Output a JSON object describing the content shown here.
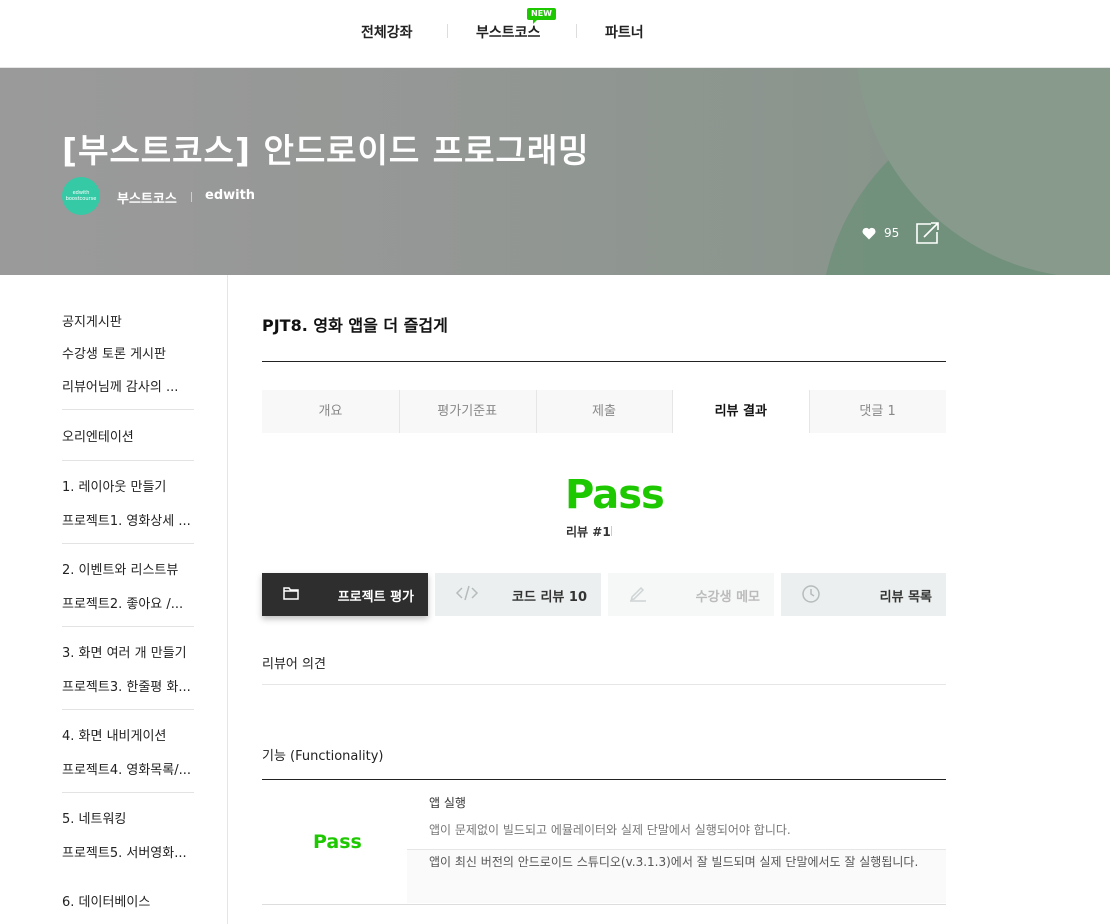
{
  "topnav": {
    "items": [
      "전체강좌",
      "부스트코스",
      "파트너"
    ],
    "new_badge": "NEW"
  },
  "hero": {
    "title": "[부스트코스] 안드로이드 프로그래밍",
    "logo_text_1": "edwith",
    "logo_text_2": "boostcourse",
    "org": "부스트코스",
    "institution": "edwith",
    "likes": "95"
  },
  "sidebar": {
    "items": [
      "공지게시판",
      "수강생 토론 게시판",
      "리뷰어님께 감사의 ...",
      "오리엔테이션",
      "1. 레이아웃 만들기",
      "프로젝트1. 영화상세 ...",
      "2. 이벤트와 리스트뷰",
      "프로젝트2. 좋아요 /...",
      "3. 화면 여러 개 만들기",
      "프로젝트3. 한줄평 화...",
      "4. 화면 내비게이션",
      "프로젝트4. 영화목록/...",
      "5. 네트워킹",
      "프로젝트5. 서버영화...",
      "6. 데이터베이스"
    ]
  },
  "project": {
    "title": "PJT8. 영화 앱을 더 즐겁게",
    "tabs": [
      "개요",
      "평가기준표",
      "제출",
      "리뷰 결과",
      "댓글 1"
    ],
    "active_tab": "리뷰 결과",
    "result": "Pass",
    "review_no": "리뷰 #1"
  },
  "actions": {
    "project_eval": "프로젝트 평가",
    "code_review": "코드 리뷰 10",
    "student_memo": "수강생 메모",
    "review_list": "리뷰 목록"
  },
  "review": {
    "opinion_label": "리뷰어 의견",
    "section_title": "기능 (Functionality)",
    "criterion_result": "Pass",
    "criterion_title": "앱 실행",
    "criterion_desc": "앱이 문제없이 빌드되고 에뮬레이터와 실제 단말에서 실행되어야 합니다.",
    "criterion_comment": "앱이 최신 버전의 안드로이드 스튜디오(v.3.1.3)에서 잘 빌드되며 실제 단말에서도 잘 실행됩니다."
  },
  "colors": {
    "accent_green": "#1ec800",
    "dark_button": "#2e2e2e"
  }
}
